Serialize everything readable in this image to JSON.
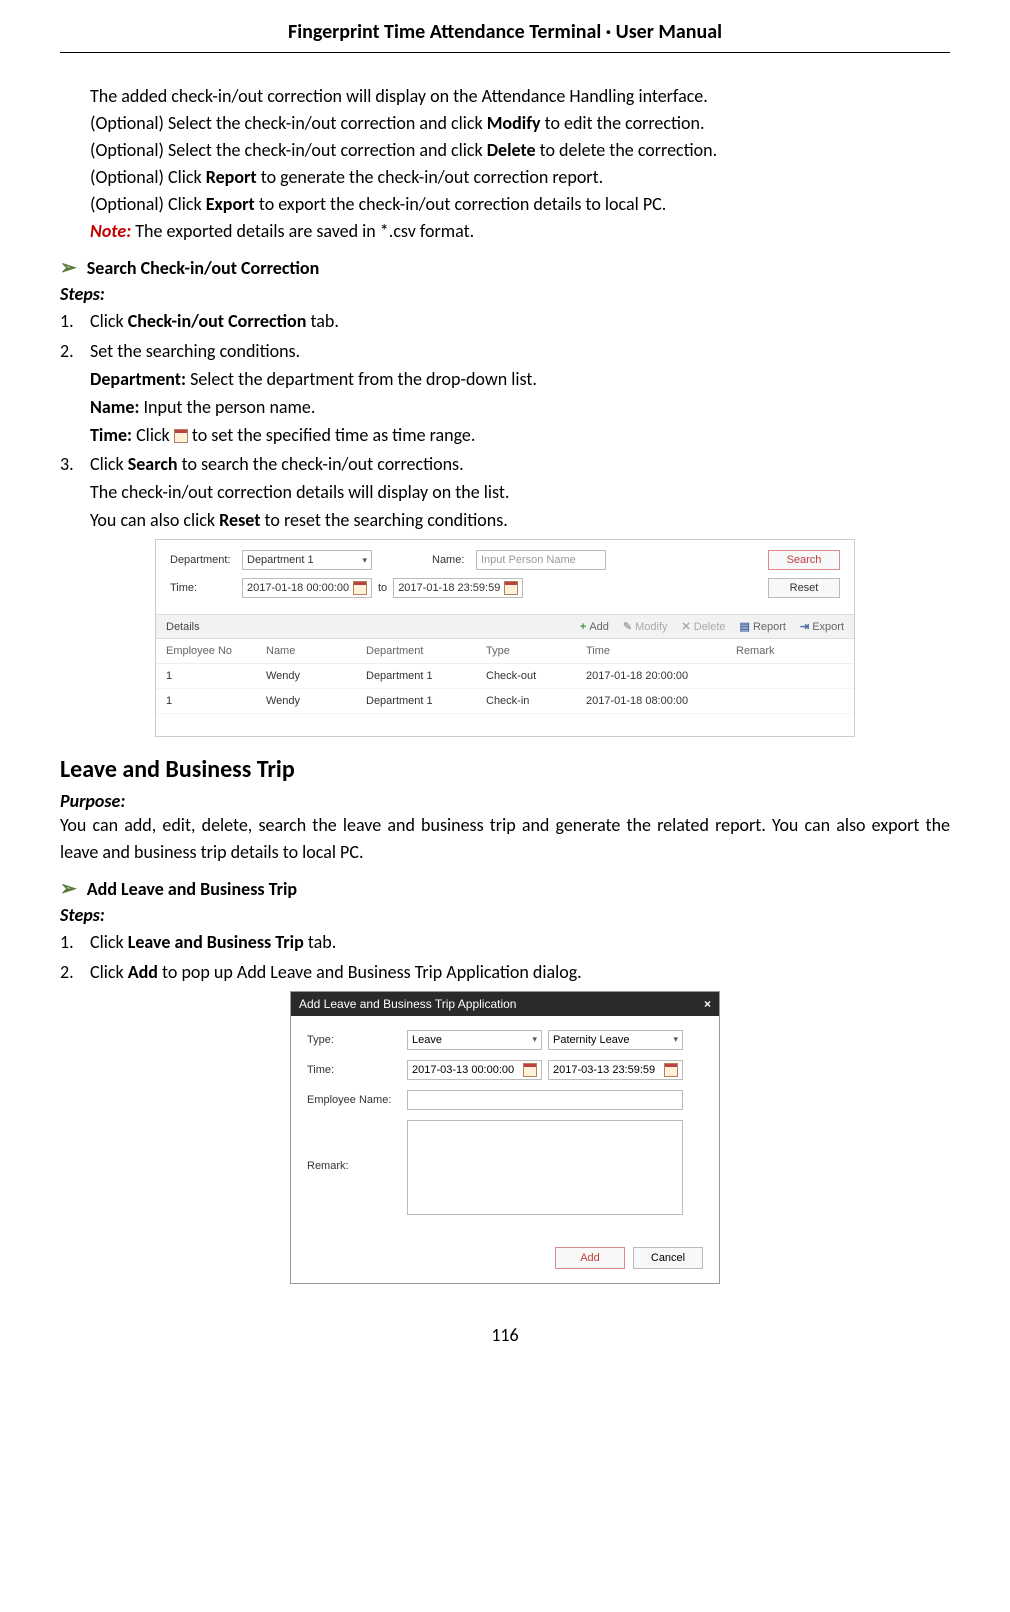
{
  "header": "Fingerprint Time Attendance Terminal · User Manual",
  "intro": {
    "l1": "The added check-in/out correction will display on the Attendance Handling interface.",
    "l2a": "(Optional) Select the check-in/out correction and click ",
    "l2b": "Modify",
    "l2c": " to edit the correction.",
    "l3a": "(Optional) Select the check-in/out correction and click ",
    "l3b": "Delete",
    "l3c": " to delete the correction.",
    "l4a": "(Optional) Click ",
    "l4b": "Report",
    "l4c": " to generate the check-in/out correction report.",
    "l5a": "(Optional) Click ",
    "l5b": "Export",
    "l5c": " to export the check-in/out correction details to local PC.",
    "noteLabel": "Note:",
    "noteText": " The exported details are saved in *.csv format."
  },
  "searchSection": {
    "heading": "Search Check-in/out Correction",
    "stepsLabel": "Steps:",
    "step1a": "Click ",
    "step1b": "Check-in/out Correction",
    "step1c": " tab.",
    "step2": "Set the searching conditions.",
    "dep_a": "Department:",
    "dep_b": " Select the department from the drop-down list.",
    "name_a": "Name:",
    "name_b": " Input the person name.",
    "time_a": "Time:",
    "time_b": " Click ",
    "time_c": " to set the specified time as time range.",
    "step3a": "Click ",
    "step3b": "Search",
    "step3c": " to search the check-in/out corrections.",
    "step3d": "The check-in/out correction details will display on the list.",
    "step3e_a": "You can also click ",
    "step3e_b": "Reset",
    "step3e_c": " to reset the searching conditions."
  },
  "ss1": {
    "depLabel": "Department:",
    "depValue": "Department 1",
    "nameLabel": "Name:",
    "namePlaceholder": "Input Person Name",
    "timeLabel": "Time:",
    "timeFrom": "2017-01-18 00:00:00",
    "timeSep": "to",
    "timeTo": "2017-01-18 23:59:59",
    "searchBtn": "Search",
    "resetBtn": "Reset",
    "detailsTitle": "Details",
    "addBtn": "Add",
    "modifyBtn": "Modify",
    "deleteBtn": "Delete",
    "reportBtn": "Report",
    "exportBtn": "Export",
    "cols": {
      "c1": "Employee No",
      "c2": "Name",
      "c3": "Department",
      "c4": "Type",
      "c5": "Time",
      "c6": "Remark"
    },
    "rows": [
      {
        "c1": "1",
        "c2": "Wendy",
        "c3": "Department 1",
        "c4": "Check-out",
        "c5": "2017-01-18 20:00:00",
        "c6": ""
      },
      {
        "c1": "1",
        "c2": "Wendy",
        "c3": "Department 1",
        "c4": "Check-in",
        "c5": "2017-01-18 08:00:00",
        "c6": ""
      }
    ]
  },
  "leaveSection": {
    "heading": "Leave and Business Trip",
    "purposeLabel": "Purpose:",
    "purposeBody": "You can add, edit, delete, search the leave and business trip and generate the related report. You can also export the leave and business trip details to local PC.",
    "subheading": "Add Leave and Business Trip",
    "stepsLabel": "Steps:",
    "step1a": "Click ",
    "step1b": "Leave and Business Trip",
    "step1c": " tab.",
    "step2a": "Click ",
    "step2b": "Add",
    "step2c": " to pop up Add Leave and Business Trip Application dialog."
  },
  "ss2": {
    "title": "Add Leave and Business Trip Application",
    "typeLabel": "Type:",
    "typeValue": "Leave",
    "subTypeValue": "Paternity Leave",
    "timeLabel": "Time:",
    "timeFrom": "2017-03-13 00:00:00",
    "timeTo": "2017-03-13 23:59:59",
    "empLabel": "Employee Name:",
    "remarkLabel": "Remark:",
    "addBtn": "Add",
    "cancelBtn": "Cancel"
  },
  "pageNum": "116"
}
